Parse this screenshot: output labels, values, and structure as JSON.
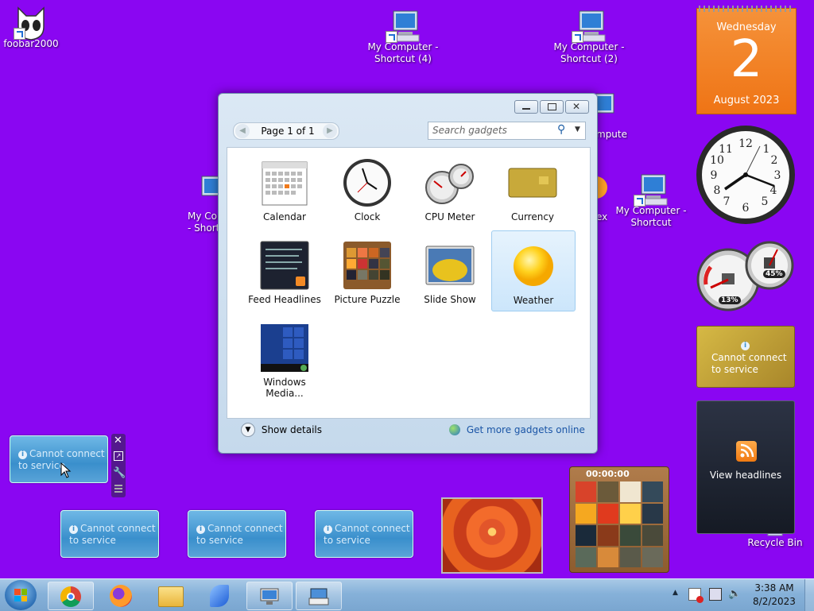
{
  "desktop": {
    "icons": [
      {
        "label": "foobar2000"
      },
      {
        "label": "My Computer - Shortcut (4)"
      },
      {
        "label": "My Computer - Shortcut (2)"
      },
      {
        "label": "My Computer - Shortcut"
      },
      {
        "label": "Recycle Bin"
      }
    ],
    "partial_labels": {
      "left_shortcut": "My Co\n- Short",
      "behind_window": "mputer",
      "behind_window2": "ex"
    }
  },
  "gallery": {
    "page_label": "Page 1 of 1",
    "search_placeholder": "Search gadgets",
    "gadgets": [
      {
        "label": "Calendar"
      },
      {
        "label": "Clock"
      },
      {
        "label": "CPU Meter"
      },
      {
        "label": "Currency"
      },
      {
        "label": "Feed Headlines"
      },
      {
        "label": "Picture Puzzle"
      },
      {
        "label": "Slide Show"
      },
      {
        "label": "Weather",
        "selected": true
      },
      {
        "label": "Windows Media..."
      }
    ],
    "show_details": "Show details",
    "get_more": "Get more gadgets online"
  },
  "calendar_gadget": {
    "weekday": "Wednesday",
    "day": "2",
    "month_year": "August 2023"
  },
  "cpu_gadget": {
    "cpu": "13%",
    "memory": "45%"
  },
  "currency_gadget": {
    "line1": "Cannot connect",
    "line2": "to service"
  },
  "feed_gadget": {
    "label": "View headlines"
  },
  "puzzle_gadget": {
    "timer": "00:00:00"
  },
  "weather_gadgets": [
    {
      "line1": "Cannot connect",
      "line2": "to service"
    },
    {
      "line1": "Cannot connect",
      "line2": "to service"
    },
    {
      "line1": "Cannot connect",
      "line2": "to service"
    },
    {
      "line1": "Cannot connect",
      "line2": "to service"
    }
  ],
  "taskbar": {
    "time": "3:38 AM",
    "date": "8/2/2023",
    "buttons": [
      "start",
      "chrome",
      "firefox",
      "explorer",
      "app",
      "remote-desktop",
      "on-screen-keyboard"
    ]
  },
  "colors": {
    "desktop": "#8a06f2",
    "calendar": "#f07a1b",
    "taskbar": "#86b1d9"
  }
}
